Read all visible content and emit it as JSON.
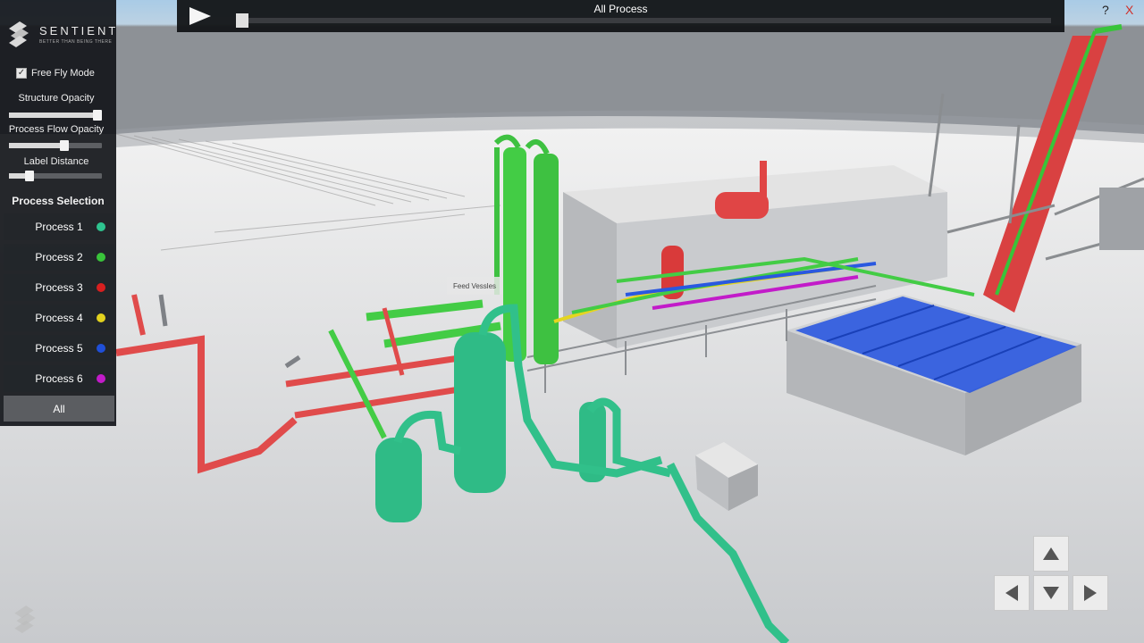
{
  "panel": {
    "brand": "SENTIENT",
    "tagline": "BETTER THAN BEING THERE",
    "free_fly_label": "Free Fly Mode",
    "free_fly_checked": true,
    "sliders": [
      {
        "label": "Structure Opacity",
        "value": 1.0
      },
      {
        "label": "Process Flow Opacity",
        "value": 0.6
      },
      {
        "label": "Label Distance",
        "value": 0.22
      }
    ],
    "process_title": "Process Selection",
    "processes": [
      {
        "label": "Process 1",
        "color": "#2ec48f"
      },
      {
        "label": "Process 2",
        "color": "#39c43a"
      },
      {
        "label": "Process 3",
        "color": "#d81f1f"
      },
      {
        "label": "Process 4",
        "color": "#e2d21e"
      },
      {
        "label": "Process 5",
        "color": "#1f4fd8"
      },
      {
        "label": "Process 6",
        "color": "#c21bc9"
      }
    ],
    "all_label": "All"
  },
  "topbar": {
    "title": "All Process",
    "progress": 0.0
  },
  "window": {
    "help_label": "?",
    "close_label": "X"
  },
  "scene": {
    "tooltip": "Feed Vessles"
  },
  "nav": {
    "up": "up-arrow",
    "down": "down-arrow",
    "left": "left-arrow",
    "right": "right-arrow"
  }
}
